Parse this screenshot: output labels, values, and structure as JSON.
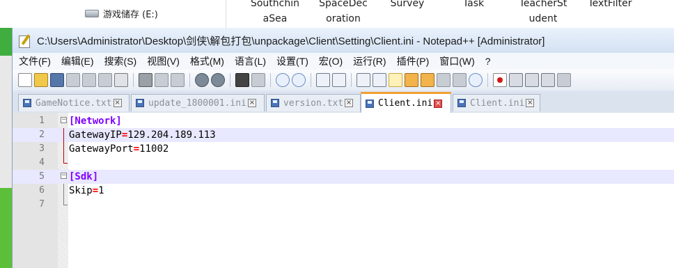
{
  "background": {
    "drive_label": "游戏储存 (E:)",
    "columns": [
      {
        "top": "Southchin",
        "bottom": "aSea"
      },
      {
        "top": "SpaceDec",
        "bottom": "oration"
      },
      {
        "top": "Survey",
        "bottom": ""
      },
      {
        "top": "Task",
        "bottom": ""
      },
      {
        "top": "TeacherSt",
        "bottom": "udent"
      },
      {
        "top": "TextFilter",
        "bottom": ""
      }
    ]
  },
  "window": {
    "title": "C:\\Users\\Administrator\\Desktop\\剑侠\\解包打包\\unpackage\\Client\\Setting\\Client.ini - Notepad++ [Administrator]"
  },
  "menu": [
    "文件(F)",
    "编辑(E)",
    "搜索(S)",
    "视图(V)",
    "格式(M)",
    "语言(L)",
    "设置(T)",
    "宏(O)",
    "运行(R)",
    "插件(P)",
    "窗口(W)",
    "?"
  ],
  "tabs": [
    {
      "label": "GameNotice.txt",
      "active": false
    },
    {
      "label": "update_1800001.ini",
      "active": false
    },
    {
      "label": "version.txt",
      "active": false
    },
    {
      "label": "Client.ini",
      "active": true
    },
    {
      "label": "Client.ini",
      "active": false
    }
  ],
  "editor": {
    "lines": [
      {
        "num": "1",
        "section": "[Network]"
      },
      {
        "num": "2",
        "key": "GatewayIP",
        "eq": "=",
        "value": "129.204.189.113"
      },
      {
        "num": "3",
        "key": "GatewayPort",
        "eq": "=",
        "value": "11002"
      },
      {
        "num": "4"
      },
      {
        "num": "5",
        "section": "[Sdk]"
      },
      {
        "num": "6",
        "key": "Skip",
        "eq": "=",
        "value": "1"
      },
      {
        "num": "7"
      }
    ]
  },
  "colors": {
    "section": "#8000ff",
    "operator": "#ff0000",
    "fold_line": "#c00000",
    "active_tab_accent": "#f0a030"
  }
}
